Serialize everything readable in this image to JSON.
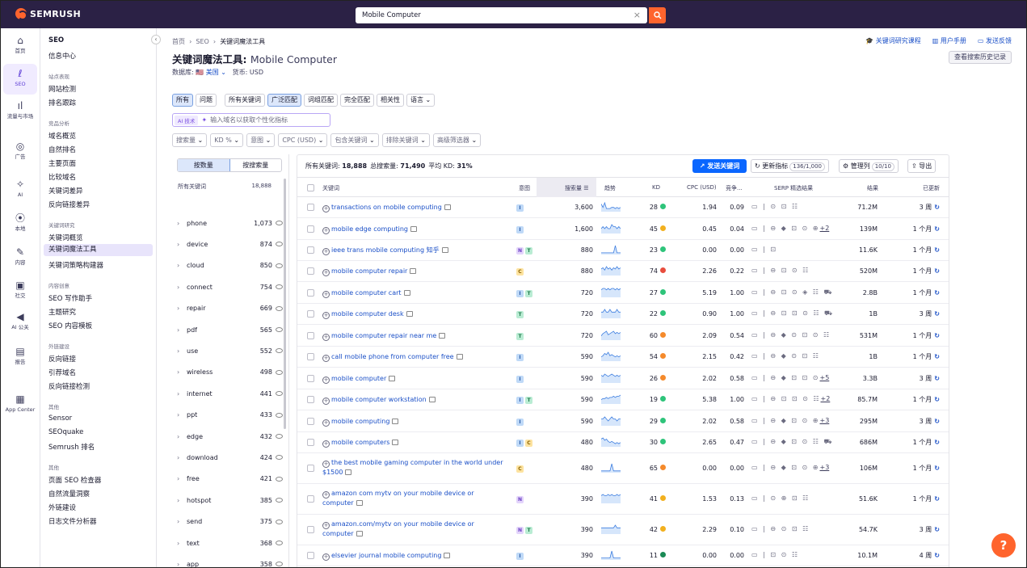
{
  "topbar": {
    "brand": "SEMRUSH",
    "search_value": "Mobile Computer",
    "clear": "×"
  },
  "rail": [
    {
      "label": "首页",
      "icon": "home-icon",
      "glyph": "⌂"
    },
    {
      "label": "SEO",
      "icon": "seo-icon",
      "glyph": "ℓ",
      "active": true
    },
    {
      "label": "流量与市场",
      "icon": "traffic-icon",
      "glyph": "ıl"
    },
    {
      "label": "广告",
      "icon": "ads-icon",
      "glyph": "◎"
    },
    {
      "label": "AI",
      "icon": "ai-icon",
      "glyph": "✧"
    },
    {
      "label": "本地",
      "icon": "local-icon",
      "glyph": "⦿"
    },
    {
      "label": "内容",
      "icon": "content-icon",
      "glyph": "✎"
    },
    {
      "label": "社交",
      "icon": "social-icon",
      "glyph": "▣"
    },
    {
      "label": "AI 公关",
      "icon": "pr-icon",
      "glyph": "◀"
    },
    {
      "label": "报告",
      "icon": "reports-icon",
      "glyph": "▤"
    },
    {
      "label": "App Center",
      "icon": "app-center-icon",
      "glyph": "▦"
    }
  ],
  "nav": {
    "title": "SEO",
    "collapse": "‹",
    "sections": [
      {
        "items": [
          "信息中心"
        ]
      },
      {
        "header": "站点表现",
        "items": [
          "网站检测",
          "排名跟踪"
        ]
      },
      {
        "header": "竞品分析",
        "items": [
          "域名概览",
          "自然排名",
          "主要页面",
          "比较域名",
          "关键词差异",
          "反向链接差异"
        ]
      },
      {
        "header": "关键词研究",
        "items": [
          "关键词概览",
          "关键词魔法工具",
          "关键词策略构建器"
        ]
      },
      {
        "header": "内容创意",
        "items": [
          "SEO 写作助手",
          "主题研究",
          "SEO 内容模板"
        ]
      },
      {
        "header": "外链建设",
        "items": [
          "反向链接",
          "引荐域名",
          "反向链接检测"
        ]
      },
      {
        "header": "其他",
        "items": [
          "Sensor",
          "SEOquake",
          "Semrush 排名"
        ]
      },
      {
        "header": "其他",
        "items": [
          "页面 SEO 检查器",
          "自然流量洞察",
          "外链建设",
          "日志文件分析器"
        ]
      }
    ],
    "selected": "关键词魔法工具"
  },
  "header": {
    "crumb": [
      "首页",
      "SEO",
      "关键词魔法工具"
    ],
    "title_prefix": "关键词魔法工具:",
    "title_query": "Mobile Computer",
    "db_label": "数据库:",
    "db_value": "🇺🇸 美国",
    "currency": "货币: USD",
    "links": [
      "关键词研究课程",
      "用户手册",
      "发送反馈"
    ],
    "history_btn": "查看搜索历史记录"
  },
  "filters": {
    "tabs1": [
      "所有",
      "问题"
    ],
    "tabs2": [
      "所有关键词",
      "广泛匹配",
      "词组匹配",
      "完全匹配",
      "相关性"
    ],
    "active_tabs": [
      "所有",
      "广泛匹配"
    ],
    "lang": "语言",
    "ai_tag": "AI 技术",
    "ai_placeholder": "输入域名以获取个性化指标",
    "drops": [
      "搜索量",
      "KD %",
      "意图",
      "CPC (USD)",
      "包含关键词",
      "排除关键词",
      "高级筛选器"
    ]
  },
  "groups": {
    "seg": [
      "按数量",
      "按搜索量"
    ],
    "head_label": "所有关键词",
    "head_count": "18,888",
    "rows": [
      {
        "name": "phone",
        "count": "1,073"
      },
      {
        "name": "device",
        "count": "874"
      },
      {
        "name": "cloud",
        "count": "850"
      },
      {
        "name": "connect",
        "count": "754"
      },
      {
        "name": "repair",
        "count": "669"
      },
      {
        "name": "pdf",
        "count": "565"
      },
      {
        "name": "use",
        "count": "552"
      },
      {
        "name": "wireless",
        "count": "498"
      },
      {
        "name": "internet",
        "count": "441"
      },
      {
        "name": "ppt",
        "count": "433"
      },
      {
        "name": "edge",
        "count": "432"
      },
      {
        "name": "download",
        "count": "424"
      },
      {
        "name": "free",
        "count": "421"
      },
      {
        "name": "hotspot",
        "count": "385"
      },
      {
        "name": "send",
        "count": "375"
      },
      {
        "name": "text",
        "count": "368"
      },
      {
        "name": "app",
        "count": "358"
      }
    ]
  },
  "results": {
    "summary": {
      "all_label": "所有关键词:",
      "all": "18,888",
      "vol_label": "总搜索量:",
      "vol": "71,490",
      "kd_label": "平均 KD:",
      "kd": "31%"
    },
    "send_btn": "发送关键词",
    "update_btn": "更新指标",
    "update_pill": "136/1,000",
    "manage_btn": "管理列",
    "manage_pill": "10/10",
    "export_btn": "导出",
    "columns": [
      "关键词",
      "意图",
      "搜索量",
      "趋势",
      "KD",
      "CPC (USD)",
      "竞争...",
      "SERP 精选结果",
      "结果",
      "已更新"
    ],
    "rows": [
      {
        "kw": "transactions on mobile computing",
        "intent": [
          "I"
        ],
        "vol": "3,600",
        "kd": "28",
        "kdc": "#2ec47a",
        "cpc": "1.94",
        "com": "0.09",
        "serp": "▭ | ⊙ ⊡ ☷",
        "more": "",
        "res": "71.2M",
        "upd": "3 周",
        "trend": [
          6,
          3,
          7,
          2,
          2,
          2,
          3,
          3,
          2,
          3,
          2,
          3
        ]
      },
      {
        "kw": "mobile edge computing",
        "intent": [
          "I"
        ],
        "vol": "1,600",
        "kd": "45",
        "kdc": "#f2b01e",
        "cpc": "0.45",
        "com": "0.04",
        "serp": "▭ | ⊖ ◆ ⊡ ⊙ ⊕",
        "more": "+2",
        "res": "139M",
        "upd": "1 个月",
        "trend": [
          2,
          3,
          2,
          3,
          2,
          2,
          4,
          3,
          3,
          2,
          3,
          2
        ]
      },
      {
        "kw": "ieee trans mobile computing 知乎",
        "intent": [
          "N",
          "T"
        ],
        "vol": "880",
        "kd": "23",
        "kdc": "#2ec47a",
        "cpc": "0.00",
        "com": "0.00",
        "serp": "▭ | ⊡",
        "more": "",
        "res": "11.6K",
        "upd": "1 个月",
        "trend": [
          1,
          1,
          1,
          1,
          1,
          1,
          1,
          1,
          9,
          1,
          1,
          1
        ]
      },
      {
        "kw": "mobile computer repair",
        "intent": [
          "C"
        ],
        "vol": "880",
        "kd": "74",
        "kdc": "#e84d3d",
        "cpc": "2.26",
        "com": "0.22",
        "serp": "▭ | ⊖ ⊡ ⊙ ☷",
        "more": "",
        "res": "520M",
        "upd": "1 个月",
        "trend": [
          5,
          6,
          4,
          7,
          5,
          6,
          4,
          6,
          5,
          7,
          5,
          6
        ]
      },
      {
        "kw": "mobile computer cart",
        "intent": [
          "I",
          "T"
        ],
        "vol": "720",
        "kd": "27",
        "kdc": "#2ec47a",
        "cpc": "5.19",
        "com": "1.00",
        "serp": "▭ | ⊖ ⊡ ⊙ ◈ ☷ ⛟",
        "more": "",
        "res": "2.8B",
        "upd": "1 个月",
        "trend": [
          5,
          6,
          6,
          5,
          6,
          5,
          6,
          6,
          5,
          6,
          5,
          6
        ]
      },
      {
        "kw": "mobile computer desk",
        "intent": [
          "T"
        ],
        "vol": "720",
        "kd": "22",
        "kdc": "#2ec47a",
        "cpc": "0.90",
        "com": "1.00",
        "serp": "▭ | ⊖ ⊡ ⊡ ⊙ ☷ ⛟",
        "more": "",
        "res": "1B",
        "upd": "3 周",
        "trend": [
          2,
          2,
          3,
          2,
          2,
          3,
          2,
          2,
          2,
          3,
          2,
          2
        ]
      },
      {
        "kw": "mobile computer repair near me",
        "intent": [
          "T"
        ],
        "vol": "720",
        "kd": "60",
        "kdc": "#f58a2b",
        "cpc": "2.09",
        "com": "0.54",
        "serp": "▭ | ⊖ ◆ ⊙ ⊡ ⊙ ☷",
        "more": "",
        "res": "531M",
        "upd": "1 个月",
        "trend": [
          3,
          5,
          6,
          7,
          4,
          5,
          6,
          7,
          5,
          6,
          5,
          6
        ]
      },
      {
        "kw": "call mobile phone from computer free",
        "intent": [
          "I"
        ],
        "vol": "590",
        "kd": "54",
        "kdc": "#f58a2b",
        "cpc": "2.15",
        "com": "0.42",
        "serp": "▭ | ⊖ ◆ ⊙ ⊡ ☷",
        "more": "",
        "res": "1B",
        "upd": "1 个月",
        "trend": [
          3,
          4,
          6,
          5,
          7,
          4,
          5,
          4,
          3,
          4,
          3,
          4
        ]
      },
      {
        "kw": "mobile computer",
        "intent": [
          "I"
        ],
        "vol": "590",
        "kd": "26",
        "kdc": "#f58a2b",
        "cpc": "2.02",
        "com": "0.58",
        "serp": "▭ | ⊖ ◆ ⊡ ⊡ ⊙",
        "more": "+5",
        "res": "3.3B",
        "upd": "3 周",
        "trend": [
          6,
          5,
          7,
          6,
          5,
          6,
          7,
          6,
          5,
          6,
          5,
          6
        ]
      },
      {
        "kw": "mobile computer workstation",
        "intent": [
          "I",
          "T"
        ],
        "vol": "590",
        "kd": "19",
        "kdc": "#2ec47a",
        "cpc": "5.38",
        "com": "1.00",
        "serp": "▭ | ⊖ ⊡ ⊡ ⊙ ☷",
        "more": "+2",
        "res": "85.7M",
        "upd": "1 个月",
        "trend": [
          3,
          4,
          4,
          5,
          4,
          5,
          5,
          6,
          5,
          6,
          6,
          7
        ]
      },
      {
        "kw": "mobile computing",
        "intent": [
          "I"
        ],
        "vol": "590",
        "kd": "29",
        "kdc": "#2ec47a",
        "cpc": "2.02",
        "com": "0.58",
        "serp": "▭ | ⊖ ◆ ⊡ ⊙ ⊕",
        "more": "+3",
        "res": "295M",
        "upd": "3 周",
        "trend": [
          3,
          3,
          4,
          3,
          2,
          3,
          4,
          3,
          3,
          2,
          3,
          3
        ]
      },
      {
        "kw": "mobile computers",
        "intent": [
          "I",
          "C"
        ],
        "vol": "480",
        "kd": "30",
        "kdc": "#2ec47a",
        "cpc": "2.65",
        "com": "0.47",
        "serp": "▭ | ⊖ ◆ ⊡ ⊙ ☷ ⛟",
        "more": "",
        "res": "686M",
        "upd": "1 个月",
        "trend": [
          6,
          7,
          5,
          6,
          4,
          3,
          4,
          3,
          2,
          3,
          2,
          3
        ]
      },
      {
        "kw": "the best mobile gaming computer in the world under $1500",
        "intent": [
          "C"
        ],
        "vol": "480",
        "kd": "65",
        "kdc": "#f58a2b",
        "cpc": "0.00",
        "com": "0.00",
        "serp": "▭ | ⊖ ◆ ⊡ ⊙ ⊕",
        "more": "+3",
        "res": "106M",
        "upd": "1 个月",
        "trend": [
          1,
          1,
          1,
          1,
          1,
          1,
          8,
          1,
          1,
          1,
          1,
          1
        ]
      },
      {
        "kw": "amazon com mytv on your mobile device or computer",
        "intent": [
          "N"
        ],
        "vol": "390",
        "kd": "41",
        "kdc": "#f2b01e",
        "cpc": "1.53",
        "com": "0.13",
        "serp": "▭ | ⊙ ⊕ ⊡ ☷",
        "more": "",
        "res": "51.6K",
        "upd": "1 个月",
        "trend": [
          6,
          7,
          6,
          6,
          7,
          6,
          7,
          6,
          6,
          7,
          6,
          7
        ]
      },
      {
        "kw": "amazon.com/mytv on your mobile device or computer",
        "intent": [
          "N",
          "T"
        ],
        "vol": "390",
        "kd": "42",
        "kdc": "#f2b01e",
        "cpc": "2.29",
        "com": "0.10",
        "serp": "▭ | ⊖ ⊙ ⊡ ☷",
        "more": "",
        "res": "54.7K",
        "upd": "3 周",
        "trend": [
          2,
          2,
          2,
          2,
          2,
          2,
          2,
          2,
          3,
          2,
          2,
          2
        ]
      },
      {
        "kw": "elsevier journal mobile computing",
        "intent": [
          "I"
        ],
        "vol": "390",
        "kd": "11",
        "kdc": "#1a8a55",
        "cpc": "0.00",
        "com": "0.00",
        "serp": "▭ | ⊡ ⊙ ☷",
        "more": "",
        "res": "10.1M",
        "upd": "4 周",
        "trend": [
          1,
          1,
          1,
          1,
          1,
          1,
          7,
          1,
          1,
          1,
          1,
          1
        ]
      }
    ]
  },
  "help": "?"
}
